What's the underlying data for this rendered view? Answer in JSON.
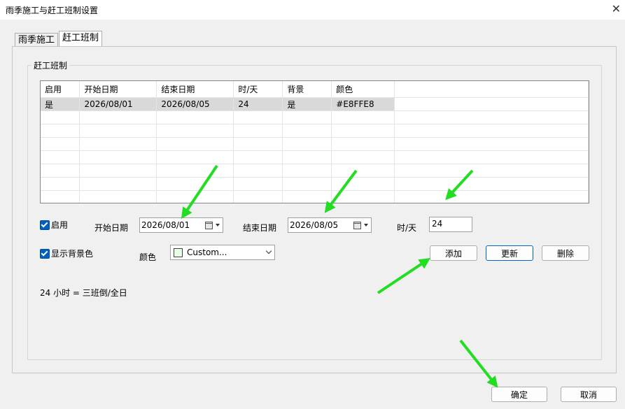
{
  "window": {
    "title": "雨季施工与赶工班制设置",
    "close_glyph": "✕"
  },
  "tabs": [
    {
      "label": "雨季施工"
    },
    {
      "label": "赶工班制"
    }
  ],
  "group": {
    "legend": "赶工班制"
  },
  "table": {
    "columns": [
      "启用",
      "开始日期",
      "结束日期",
      "时/天",
      "背景",
      "颜色"
    ],
    "rows": [
      [
        "是",
        "2026/08/01",
        "2026/08/05",
        "24",
        "是",
        "#E8FFE8"
      ]
    ]
  },
  "form": {
    "enable_label": "启用",
    "start_label": "开始日期",
    "start_value": "2026/08/01",
    "end_label": "结束日期",
    "end_value": "2026/08/05",
    "hours_label": "时/天",
    "hours_value": "24",
    "show_bg_label": "显示背景色",
    "color_label": "颜色",
    "color_value": "Custom...",
    "swatch_color": "#E8FFE8"
  },
  "actions": {
    "add": "添加",
    "update": "更新",
    "delete": "删除"
  },
  "info_text": "24 小时 = 三班倒/全日",
  "footer": {
    "ok": "确定",
    "cancel": "取消"
  },
  "colors": {
    "accent": "#0060c0",
    "annotation_arrow": "#22dd22"
  }
}
